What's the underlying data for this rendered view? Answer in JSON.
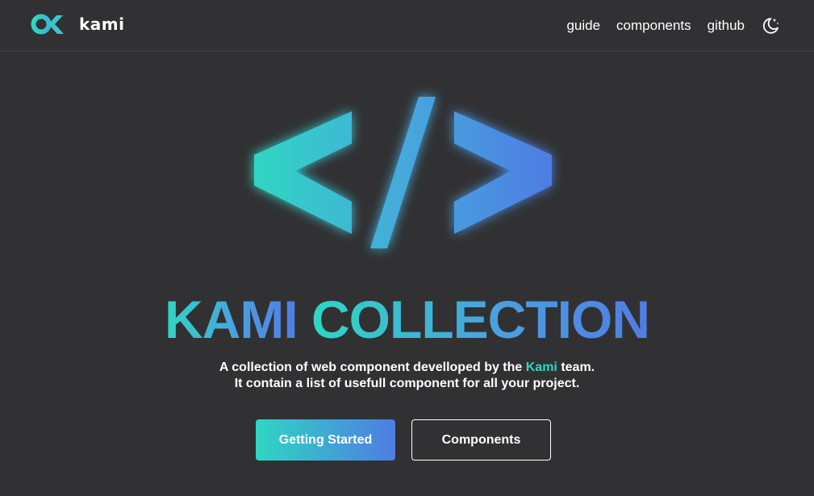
{
  "header": {
    "brand_name": "kami",
    "nav": [
      {
        "label": "guide"
      },
      {
        "label": "components"
      },
      {
        "label": "github"
      }
    ],
    "theme_toggle_icon": "moon-stars-icon"
  },
  "hero": {
    "icon": "code-brackets-icon",
    "title_word1": "KAMI",
    "title_word2": "COLLECTION",
    "description": {
      "line1_before": "A collection of web component develloped by the ",
      "line1_accent": "Kami",
      "line1_after": " team.",
      "line2": "It contain a list of usefull component for all your project."
    },
    "buttons": {
      "primary_label": "Getting Started",
      "secondary_label": "Components"
    }
  },
  "colors": {
    "background": "#313133",
    "accent_teal": "#2fd6c3",
    "accent_blue": "#4f7ce3",
    "text": "#ffffff"
  }
}
